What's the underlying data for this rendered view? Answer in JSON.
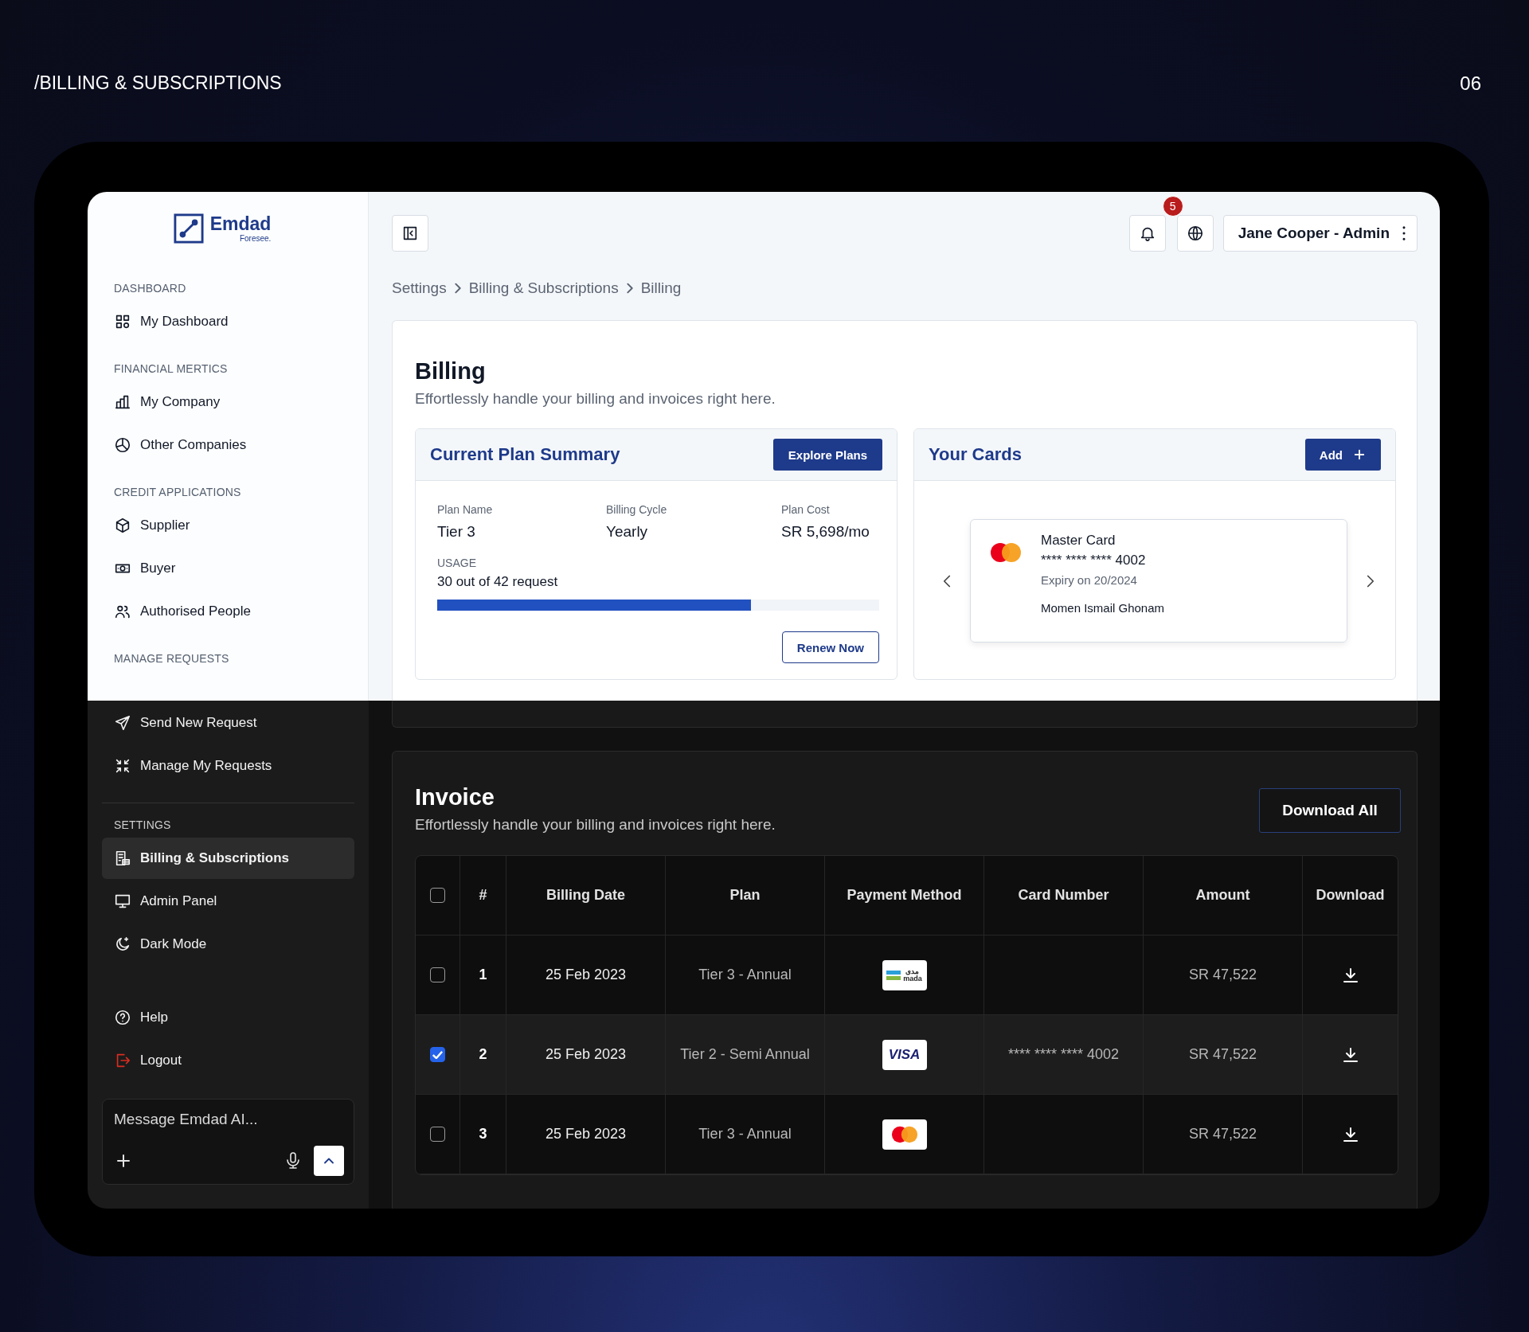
{
  "slide": {
    "title": "/BILLING & SUBSCRIPTIONS",
    "page_number": "06"
  },
  "light_part": {
    "sidebar": {
      "logo": {
        "name": "Emdad",
        "tagline": "Foresee."
      },
      "sections": [
        {
          "heading": "DASHBOARD",
          "items": [
            {
              "label": "My Dashboard",
              "selected": false
            }
          ]
        },
        {
          "heading": "FINANCIAL MERTICS",
          "items": [
            {
              "label": "My Company",
              "selected": false
            },
            {
              "label": "Other Companies",
              "selected": false
            }
          ]
        },
        {
          "heading": "CREDIT APPLICATIONS",
          "items": [
            {
              "label": "Supplier",
              "selected": false
            },
            {
              "label": "Buyer",
              "selected": false
            },
            {
              "label": "Authorised People",
              "selected": false
            }
          ]
        },
        {
          "heading": "MANAGE REQUESTS"
        }
      ]
    },
    "topbar": {
      "notifications_badge": "5",
      "user_menu": "Jane Cooper - Admin"
    },
    "breadcrumb": [
      "Settings",
      "Billing & Subscriptions",
      "Billing"
    ],
    "billing": {
      "title": "Billing",
      "subtitle": "Effortlessly handle your billing and invoices right here.",
      "plan_summary": {
        "title": "Current Plan Summary",
        "action": "Explore Plans",
        "fields": [
          {
            "label": "Plan Name",
            "value": "Tier 3"
          },
          {
            "label": "Billing Cycle",
            "value": "Yearly"
          },
          {
            "label": "Plan Cost",
            "value": "SR 5,698/mo"
          }
        ],
        "usage": {
          "label": "USAGE",
          "text": "30 out of 42 request",
          "level": 0.71
        },
        "renew": "Renew Now"
      },
      "cards": {
        "title": "Your Cards",
        "action": "Add",
        "items": [
          {
            "name": "Master Card",
            "number": "**** **** **** 4002",
            "expiry": "Expiry on 20/2024",
            "holder": "Momen Ismail Ghonam"
          }
        ]
      }
    }
  },
  "dark_part": {
    "sidebar": {
      "sections": [
        {
          "items": [
            {
              "label": "Send New Request",
              "selected": false
            },
            {
              "label": "Manage My Requests",
              "selected": false
            }
          ]
        },
        {
          "heading": "SETTINGS",
          "items": [
            {
              "label": "Billing & Subscriptions",
              "selected": true
            },
            {
              "label": "Admin Panel",
              "selected": false
            },
            {
              "label": "Dark Mode",
              "selected": false
            }
          ]
        }
      ],
      "bottom_items": [
        {
          "label": "Help",
          "kind": "normal",
          "selected": false
        },
        {
          "label": "Logout",
          "kind": "danger",
          "selected": false
        }
      ],
      "chat": {
        "placeholder": "Message Emdad AI..."
      }
    },
    "invoice": {
      "title": "Invoice",
      "subtitle": "Effortlessly handle your billing and invoices right here.",
      "action": "Download All",
      "table": {
        "all_checked": false,
        "columns": [
          "#",
          "Billing Date",
          "Plan",
          "Payment Method",
          "Card Number",
          "Amount",
          "Download"
        ],
        "rows": [
          {
            "number": "1",
            "date": "25 Feb 2023",
            "plan": "Tier 3 - Annual",
            "payment": {
              "kind": "mada",
              "label": "mada",
              "label_ar": "مدى"
            },
            "amount": "SR 47,522",
            "selected": false
          },
          {
            "number": "2",
            "date": "25 Feb 2023",
            "plan": "Tier 2 - Semi Annual",
            "payment": {
              "kind": "visa",
              "label": "VISA"
            },
            "card_number": "**** **** **** 4002",
            "amount": "SR 47,522",
            "selected": true
          },
          {
            "number": "3",
            "date": "25 Feb 2023",
            "plan": "Tier 3 - Annual",
            "payment": {
              "kind": "mastercard"
            },
            "amount": "SR 47,522",
            "selected": false
          }
        ]
      }
    }
  }
}
